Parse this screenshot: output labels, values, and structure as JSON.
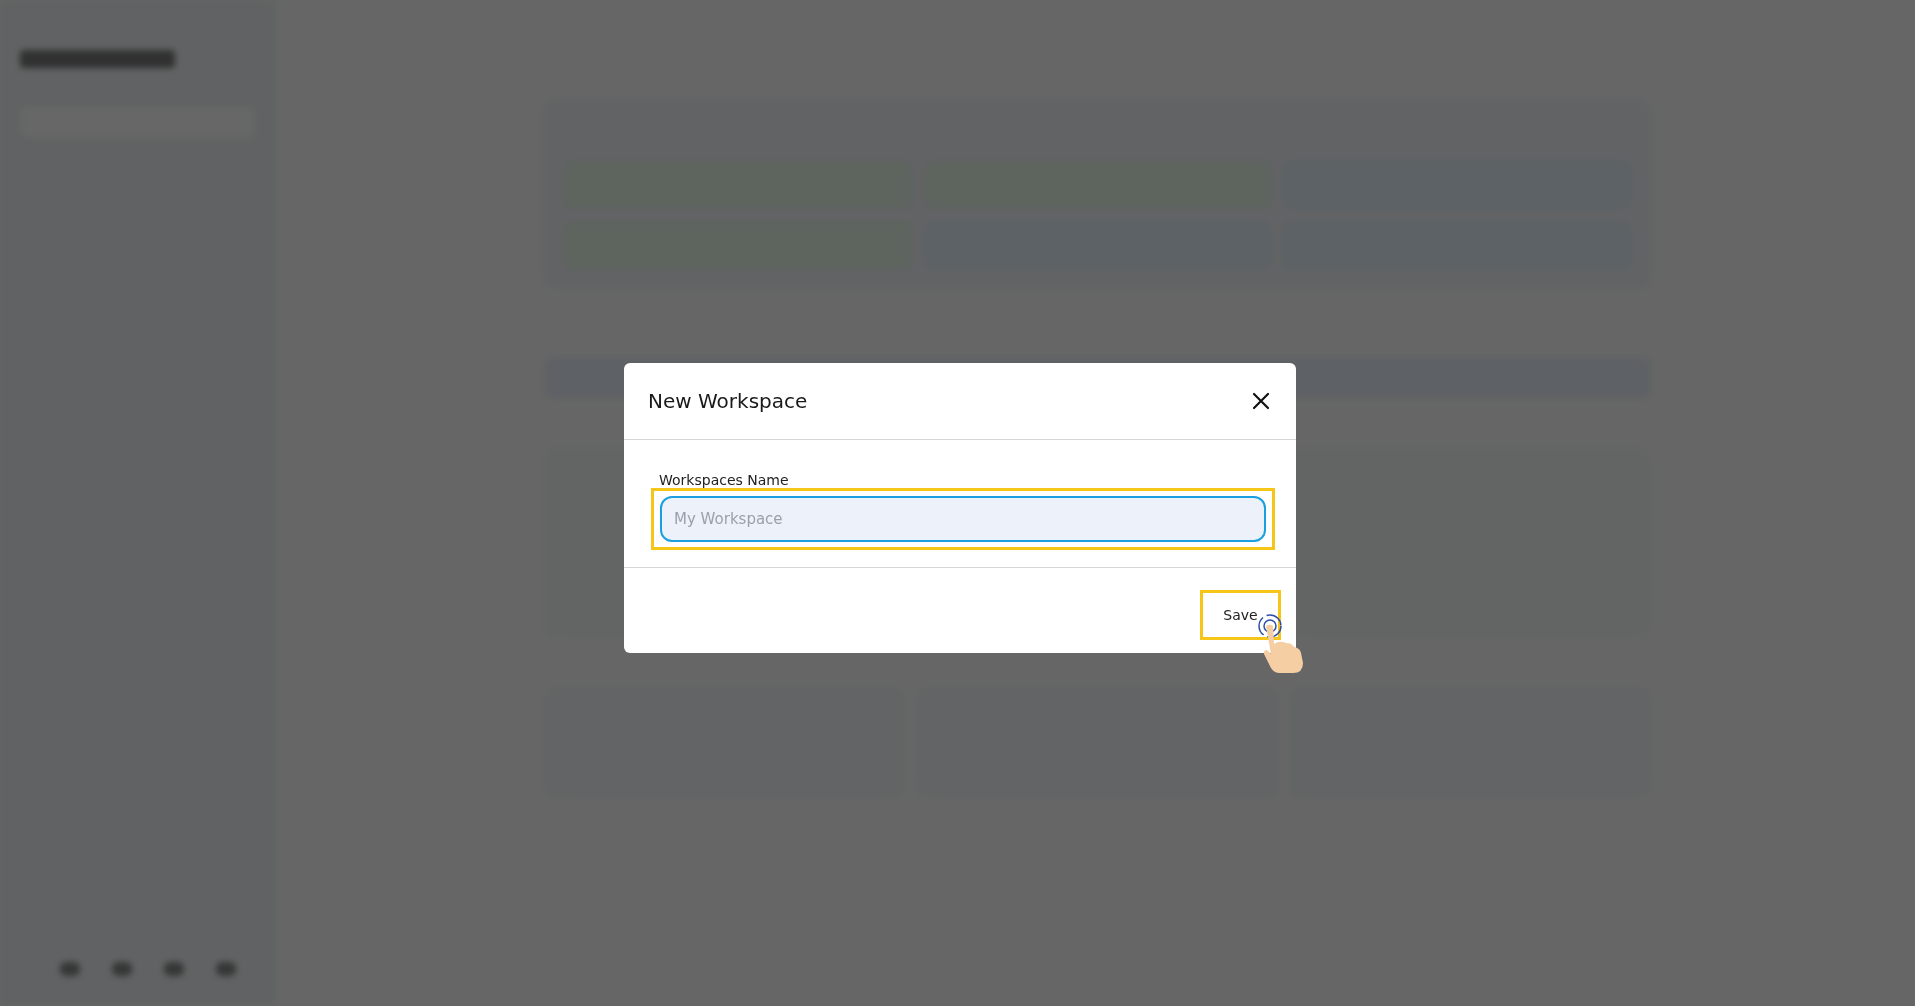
{
  "dialog": {
    "title": "New Workspace",
    "field": {
      "label": "Workspaces Name",
      "placeholder": "My Workspace",
      "focused": true,
      "highlighted": true
    },
    "buttons": [
      {
        "label": "Save",
        "highlighted": true,
        "tapped": true
      }
    ]
  }
}
